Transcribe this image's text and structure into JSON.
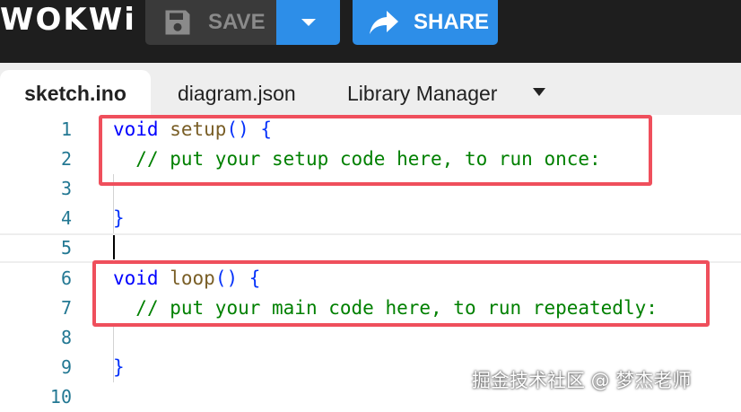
{
  "header": {
    "logo": "WOKWi",
    "save_label": "SAVE",
    "share_label": "SHARE"
  },
  "tabs": [
    {
      "label": "sketch.ino",
      "active": true
    },
    {
      "label": "diagram.json",
      "active": false
    },
    {
      "label": "Library Manager",
      "active": false
    }
  ],
  "editor": {
    "line_numbers": [
      "1",
      "2",
      "3",
      "4",
      "5",
      "6",
      "7",
      "8",
      "9",
      "10"
    ],
    "code": {
      "setup_kw": "void",
      "setup_fn": "setup",
      "setup_paren": "()",
      "setup_brace": "{",
      "setup_comment": "// put your setup code here, to run once:",
      "setup_close": "}",
      "loop_kw": "void",
      "loop_fn": "loop",
      "loop_paren": "()",
      "loop_brace": "{",
      "loop_comment": "// put your main code here, to run repeatedly:",
      "loop_close": "}"
    }
  },
  "colors": {
    "accent": "#2d8ee8",
    "highlight": "#ef4f5c",
    "topbar": "#1e1e1e"
  },
  "watermark": "掘金技术社区 @ 梦杰老师"
}
